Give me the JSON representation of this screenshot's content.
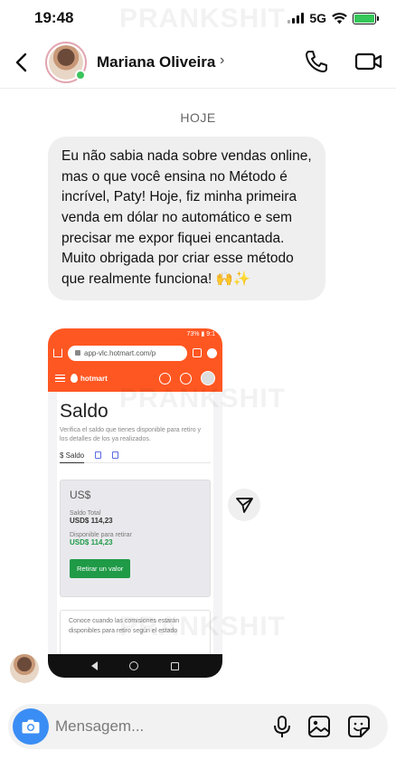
{
  "status_bar": {
    "time": "19:48",
    "network": "5G"
  },
  "watermark": "PRANKSHIT",
  "header": {
    "contact_name": "Mariana Oliveira",
    "chevron": "›"
  },
  "icons": {
    "back": "chevron-left-icon",
    "call": "phone-icon",
    "video": "video-camera-icon",
    "share": "paper-plane-icon",
    "camera": "camera-icon",
    "mic": "microphone-icon",
    "image": "image-icon",
    "sticker": "sticker-icon"
  },
  "colors": {
    "accent": "#3a8df4",
    "online": "#3dc45d",
    "hotmart_orange": "#ff5722",
    "hotmart_green": "#1f9a47"
  },
  "chat": {
    "date_label": "HOJE",
    "message_text": "Eu não sabia nada sobre vendas online, mas o que você ensina no Método é incrível, Paty! Hoje, fiz minha primeira venda em dólar no automático e sem precisar me expor fiquei encantada. Muito obrigada por criar esse método que realmente funciona! 🙌✨"
  },
  "shared_screenshot": {
    "status_text": "73% ▮ 9:1",
    "url": "app-vlc.hotmart.com/p",
    "brand": "hotmart",
    "page_title": "Saldo",
    "description": "Verifica el saldo que tienes disponible para retiro y los detalles de los ya realizados.",
    "tab_label": "$ Saldo",
    "currency": "US$",
    "total_label": "Saldo Total",
    "total_value": "USD$ 114,23",
    "available_label": "Disponible para retirar",
    "available_value": "USD$ 114,23",
    "withdraw_button": "Retirar un valor",
    "info_text": "Conoce cuando las comisiones estarán disponibles para retiro según el estado"
  },
  "composer": {
    "placeholder": "Mensagem..."
  }
}
